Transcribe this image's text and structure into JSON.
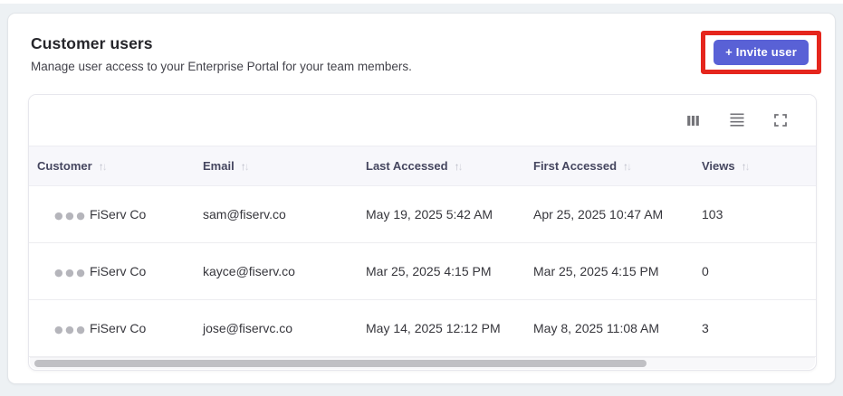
{
  "header": {
    "title": "Customer users",
    "subtitle": "Manage user access to your Enterprise Portal for your team members.",
    "invite_button_label": "+ Invite user"
  },
  "colors": {
    "accent": "#5961d6",
    "annotation_red": "#e5261d",
    "header_row_bg": "#f7f7fb",
    "page_bg": "#edf1f4"
  },
  "icons": {
    "sort_up": "↑",
    "sort_down": "↓",
    "row_more": "●●●",
    "toolbar": [
      "show-hide-columns-icon",
      "row-density-icon",
      "fullscreen-icon"
    ]
  },
  "table": {
    "columns": [
      {
        "label": "Customer"
      },
      {
        "label": "Email"
      },
      {
        "label": "Last Accessed"
      },
      {
        "label": "First Accessed"
      },
      {
        "label": "Views"
      }
    ],
    "rows": [
      {
        "customer": "FiServ Co",
        "email": "sam@fiserv.co",
        "last_accessed": "May 19, 2025 5:42 AM",
        "first_accessed": "Apr 25, 2025 10:47 AM",
        "views": "103"
      },
      {
        "customer": "FiServ Co",
        "email": "kayce@fiserv.co",
        "last_accessed": "Mar 25, 2025 4:15 PM",
        "first_accessed": "Mar 25, 2025 4:15 PM",
        "views": "0"
      },
      {
        "customer": "FiServ Co",
        "email": "jose@fiservc.co",
        "last_accessed": "May 14, 2025 12:12 PM",
        "first_accessed": "May 8, 2025 11:08 AM",
        "views": "3"
      }
    ]
  }
}
